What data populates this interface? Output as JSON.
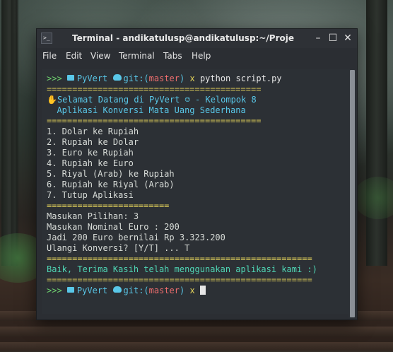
{
  "window": {
    "title": "Terminal - andikatulusp@andikatulusp:~/Proje",
    "controls": [
      "minimize-icon",
      "maximize-icon",
      "close-icon"
    ]
  },
  "menubar": {
    "items": [
      "File",
      "Edit",
      "View",
      "Terminal",
      "Tabs",
      "Help"
    ]
  },
  "prompt": {
    "arrows": ">>>",
    "dir": "PyVert",
    "git_label": "git:(",
    "branch": "master",
    "git_close": ")",
    "x": "x",
    "command": "python script.py"
  },
  "output": {
    "sep1": "==========================================",
    "welcome": "Selamat Datang di PyVert ☺ - Kelompok 8",
    "subtitle": "  Aplikasi Konversi Mata Uang Sederhana",
    "sep2": "==========================================",
    "menu": [
      "1. Dolar ke Rupiah",
      "2. Rupiah ke Dolar",
      "3. Euro ke Rupiah",
      "4. Rupiah ke Euro",
      "5. Riyal (Arab) ke Rupiah",
      "6. Rupiah ke Riyal (Arab)",
      "7. Tutup Aplikasi"
    ],
    "sep3": "========================",
    "input1": "Masukan Pilihan: 3",
    "input2": "Masukan Nominal Euro : 200",
    "result": "Jadi 200 Euro bernilai Rp 3.323.200",
    "repeat": "Ulangi Konversi? [Y/T] ... T",
    "sep4": "====================================================",
    "goodbye": "Baik, Terima Kasih telah menggunakan aplikasi kami :)",
    "sep5": "===================================================="
  },
  "colors": {
    "prompt_green": "#6fd46f",
    "dir_cyan": "#59c7e8",
    "separator_yellow": "#e3d25a",
    "branch_red": "#ef6e6e",
    "goodbye_teal": "#4fd6b5",
    "terminal_bg": "#2c3035"
  }
}
